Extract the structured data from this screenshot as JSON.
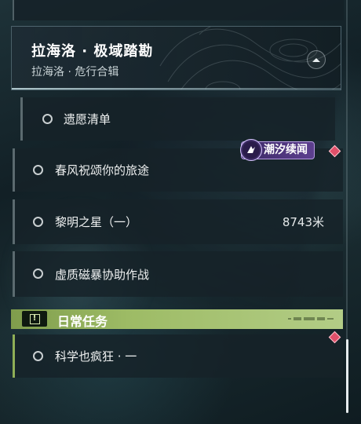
{
  "quest_group": {
    "title": "拉海洛 · 极域踏勘",
    "subtitle": "拉海洛 · 危行合辑",
    "collapse_icon": "chevron-up-icon"
  },
  "tasks": [
    {
      "label": "遗愿清单",
      "distance": ""
    },
    {
      "label": "春风祝颂你的旅途",
      "distance": ""
    },
    {
      "label": "黎明之星（一）",
      "distance": "8743米"
    },
    {
      "label": "虚质磁暴协助作战",
      "distance": ""
    }
  ],
  "tidal_badge": {
    "label": "潮汐续闻",
    "color": "#5d3f8f"
  },
  "daily_section": {
    "title": "日常任务",
    "icon": "exclamation-icon",
    "color": "#9dbb65",
    "tasks": [
      {
        "label": "科学也疯狂 · 一"
      }
    ]
  },
  "marker_color": "#e0506a"
}
